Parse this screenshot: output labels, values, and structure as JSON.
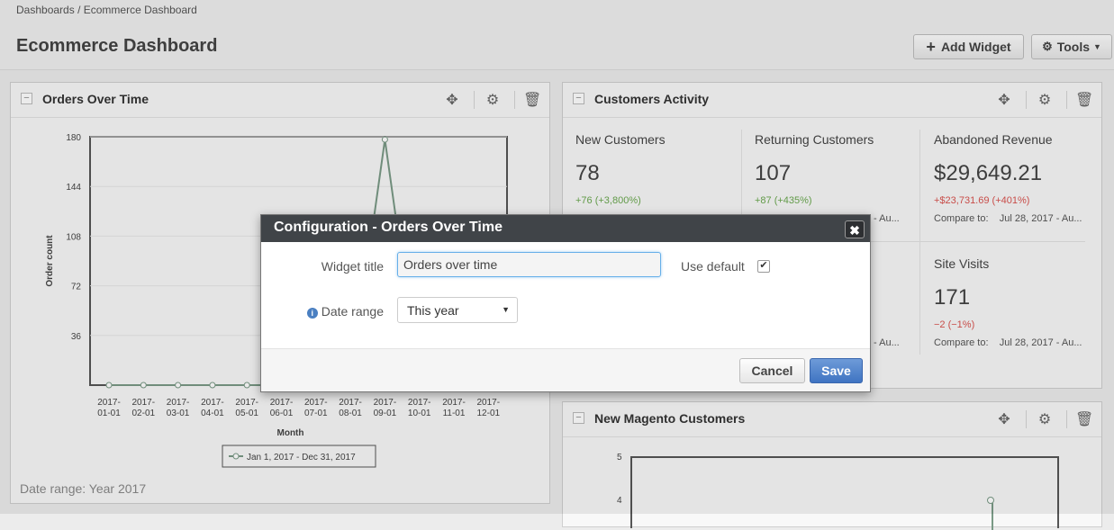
{
  "breadcrumb": [
    "Dashboards",
    "/",
    "Ecommerce Dashboard"
  ],
  "page_title": "Ecommerce Dashboard",
  "toolbar": {
    "add_widget_label": "Add Widget",
    "tools_label": "Tools"
  },
  "icons": {
    "plus": "plus-icon",
    "gear": "gear-icon",
    "move": "move-icon",
    "trash": "trash-icon",
    "collapse": "minus-icon",
    "close": "close-icon",
    "info": "info-icon"
  },
  "orders_widget": {
    "title": "Orders Over Time",
    "footer": "Date range: Year 2017",
    "legend": "Jan 1, 2017 - Dec 31, 2017",
    "xlabel": "Month",
    "ylabel": "Order count"
  },
  "chart_data": {
    "type": "line",
    "ylabel": "Order count",
    "xlabel": "Month",
    "ylim": [
      0,
      180
    ],
    "yticks": [
      "36",
      "72",
      "108",
      "144",
      "180"
    ],
    "categories": [
      "2017-01-01",
      "2017-02-01",
      "2017-03-01",
      "2017-04-01",
      "2017-05-01",
      "2017-06-01",
      "2017-07-01",
      "2017-08-01",
      "2017-09-01",
      "2017-10-01",
      "2017-11-01",
      "2017-12-01"
    ],
    "series": [
      {
        "name": "Jan 1, 2017 - Dec 31, 2017",
        "values": [
          0,
          0,
          0,
          0,
          0,
          0,
          0,
          0,
          178,
          0,
          0,
          0
        ]
      }
    ],
    "legend_position": "bottom",
    "color": "#7a9a86"
  },
  "customers_widget": {
    "title": "Customers Activity",
    "new_customers": {
      "label": "New Customers",
      "value": "78",
      "change": "+76 (+3,800%)"
    },
    "returning_customers": {
      "label": "Returning Customers",
      "value": "107",
      "change": "+87 (+435%)",
      "compare_tail": "- Au..."
    },
    "abandoned_revenue": {
      "label": "Abandoned Revenue",
      "value": "$29,649.21",
      "change": "+$23,731.69 (+401%)",
      "compare_label": "Compare to:",
      "compare_value": "Jul 28, 2017 - Au..."
    },
    "hidden_row_compare_tail": "- Au...",
    "site_visits": {
      "label": "Site Visits",
      "value": "171",
      "change": "−2 (−1%)",
      "compare_label": "Compare to:",
      "compare_value": "Jul 28, 2017 - Au..."
    }
  },
  "magento_widget": {
    "title": "New Magento Customers",
    "yticks": [
      "5",
      "4"
    ]
  },
  "modal": {
    "title": "Configuration - Orders Over Time",
    "widget_title_label": "Widget title",
    "widget_title_value": "Orders over time",
    "use_default_label": "Use default",
    "date_range_label": "Date range",
    "date_range_value": "This year",
    "cancel_label": "Cancel",
    "save_label": "Save"
  }
}
